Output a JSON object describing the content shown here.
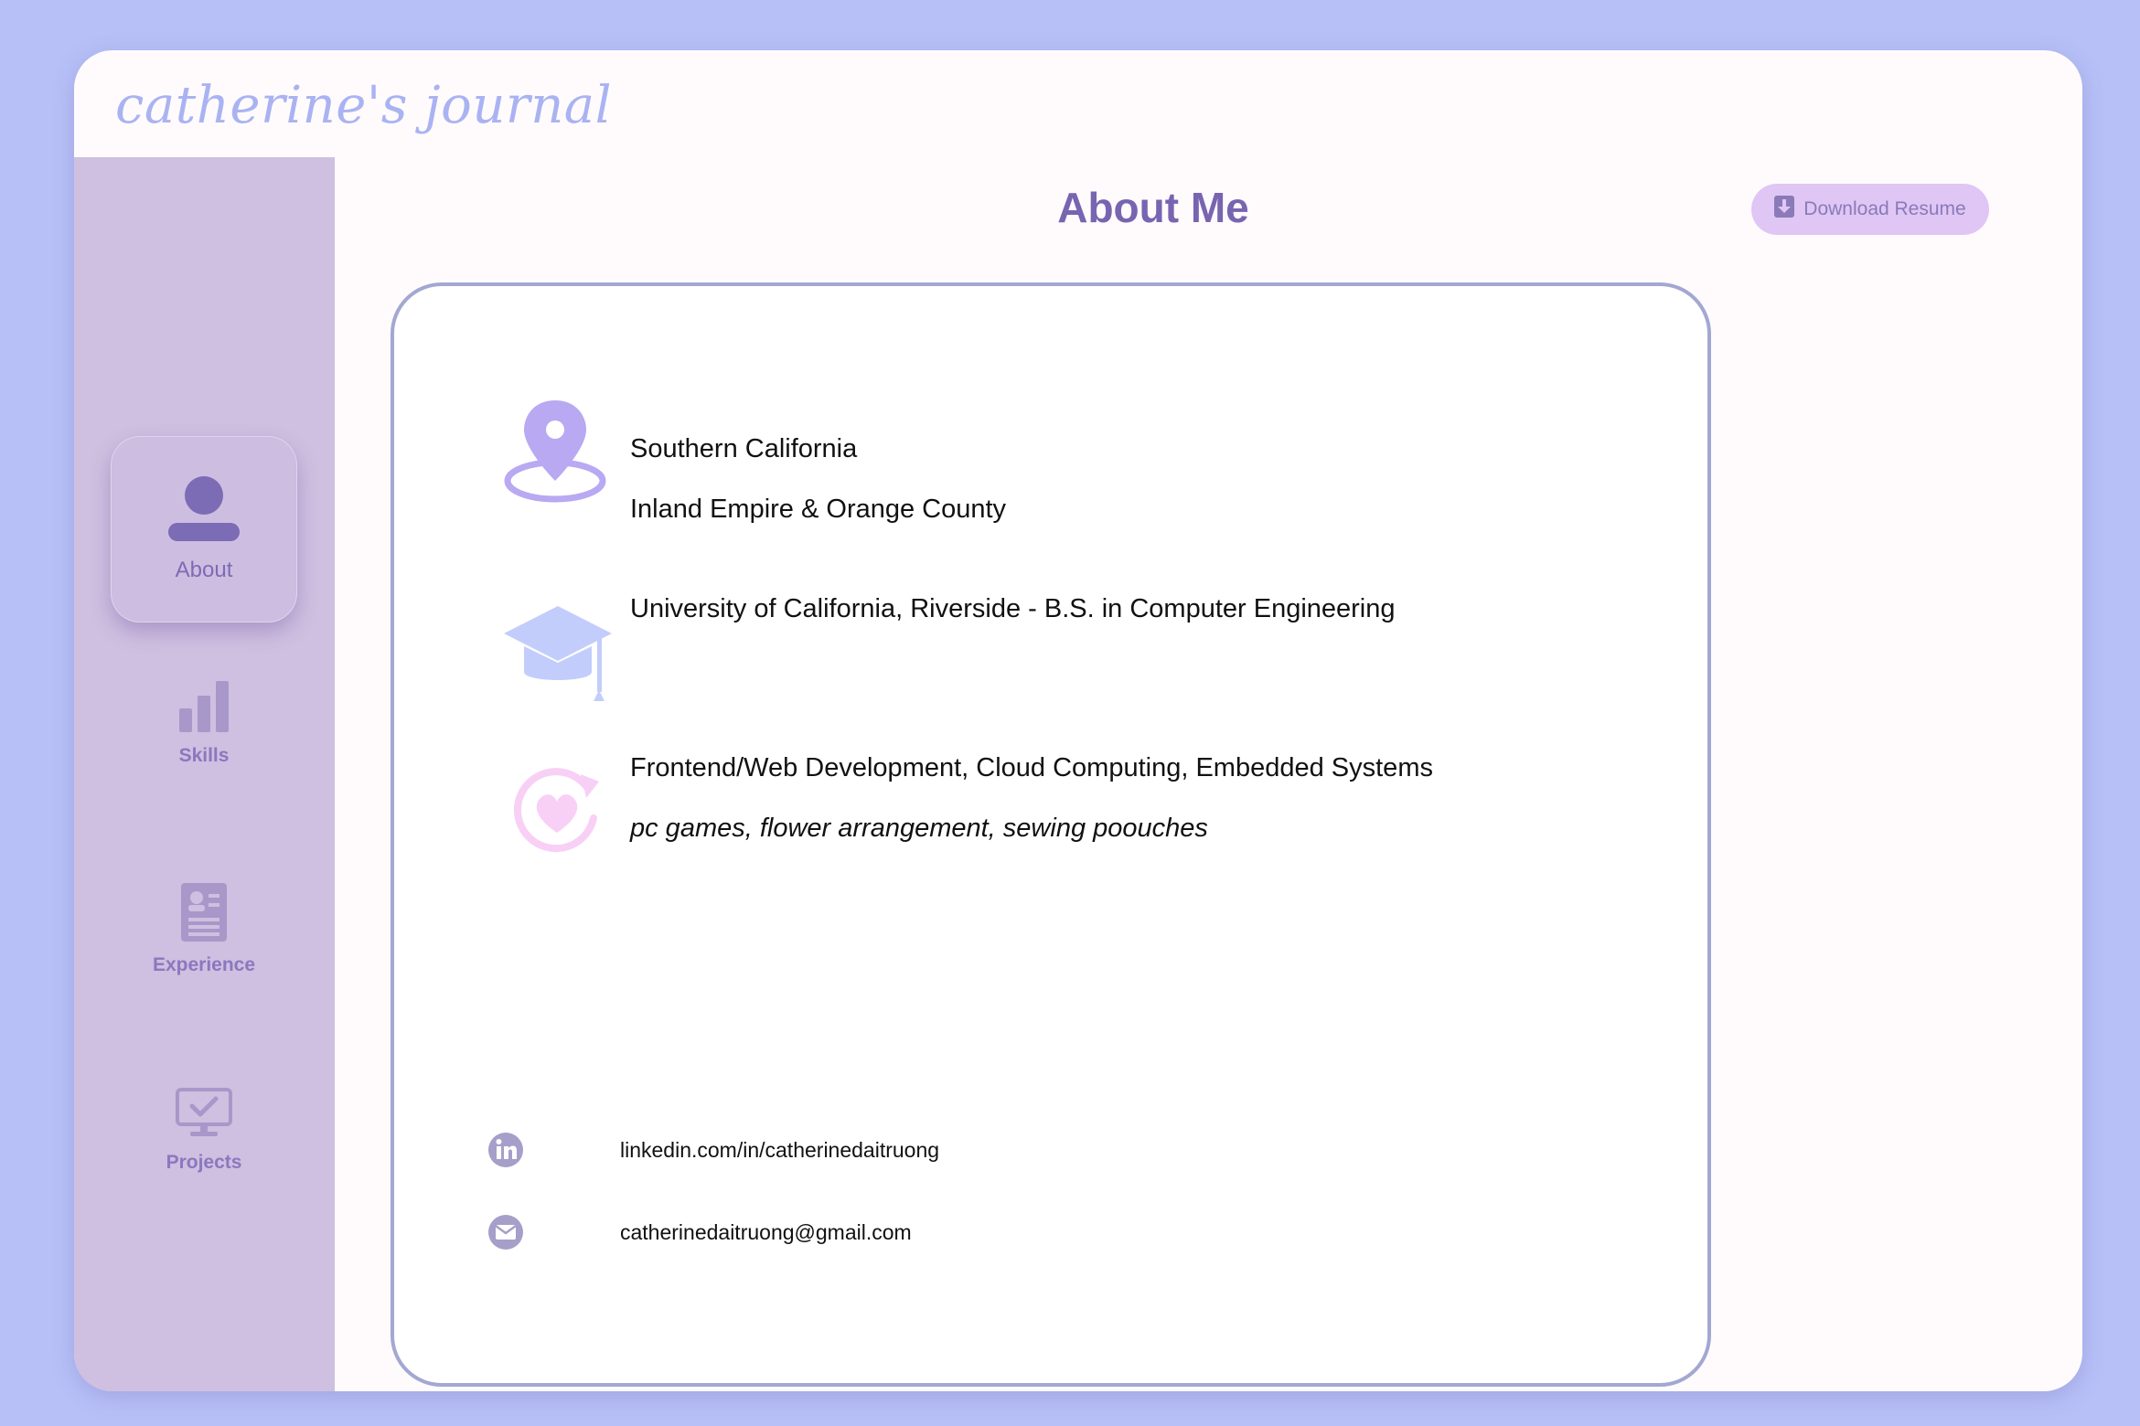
{
  "brand": {
    "title": "catherine's journal"
  },
  "sidebar": {
    "items": [
      {
        "label": "About",
        "icon": "person-icon",
        "active": true
      },
      {
        "label": "Skills",
        "icon": "bar-chart-icon",
        "active": false
      },
      {
        "label": "Experience",
        "icon": "resume-icon",
        "active": false
      },
      {
        "label": "Projects",
        "icon": "monitor-check-icon",
        "active": false
      }
    ]
  },
  "header": {
    "title": "About Me",
    "download_label": "Download Resume"
  },
  "about": {
    "location_line1": "Southern California",
    "location_line2": "Inland Empire & Orange County",
    "education": "University of California, Riverside - B.S. in Computer Engineering",
    "interests": "Frontend/Web Development, Cloud Computing, Embedded Systems",
    "hobbies": "pc games, flower arrangement, sewing poouches"
  },
  "contacts": {
    "linkedin": "linkedin.com/in/catherinedaitruong",
    "email": "catherinedaitruong@gmail.com"
  },
  "colors": {
    "background": "#b8c0f8",
    "sidebar": "#cfbfe0",
    "accent": "#7864b0",
    "button": "#dfc6f5",
    "card_border": "#a3a8d2"
  }
}
